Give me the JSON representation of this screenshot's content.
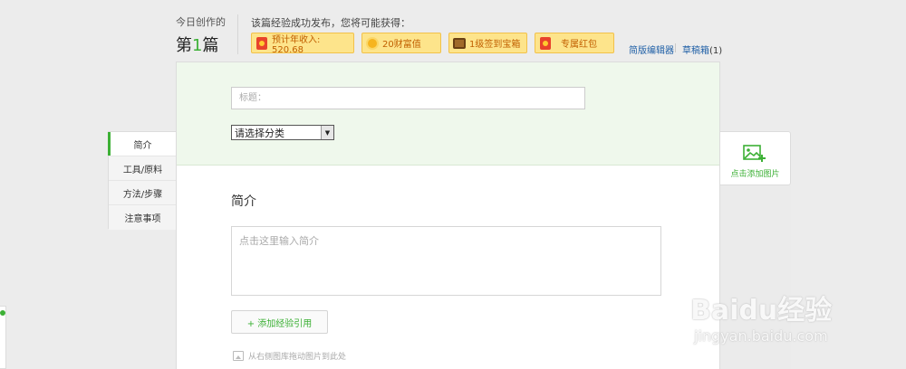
{
  "header": {
    "today_label": "今日创作的",
    "count_prefix": "第",
    "count_num": "1",
    "count_suffix": "篇",
    "reward_title": "该篇经验成功发布，您将可能获得：",
    "rewards": [
      {
        "label": "预计年收入: 520.68",
        "icon": "red-envelope-icon"
      },
      {
        "label": "20财富值",
        "icon": "coin-icon"
      },
      {
        "label": "1级签到宝箱",
        "icon": "treasure-chest-icon"
      },
      {
        "label": "专属红包",
        "icon": "red-envelope-icon"
      }
    ],
    "links": {
      "simple_editor": "简版编辑器",
      "drafts": "草稿箱",
      "drafts_count": "(1)"
    }
  },
  "editor": {
    "title_placeholder": "标题：",
    "category_select": "请选择分类",
    "section_title": "简介",
    "intro_placeholder": "点击这里输入简介",
    "add_reference": "+ 添加经验引用",
    "drag_hint": "从右侧图库拖动图片到此处"
  },
  "left_nav": {
    "items": [
      "简介",
      "工具/原料",
      "方法/步骤",
      "注意事项"
    ],
    "active_index": 0
  },
  "image_panel": {
    "label": "点击添加图片"
  },
  "watermark": {
    "main": "Baidu经验",
    "sub": "jingyan.baidu.com"
  },
  "colors": {
    "accent_green": "#3cb035",
    "reward_bg": "#fde48b",
    "reward_text": "#c15f00",
    "link_blue": "#1f5fa6",
    "editor_top_bg": "#eff8ec"
  }
}
